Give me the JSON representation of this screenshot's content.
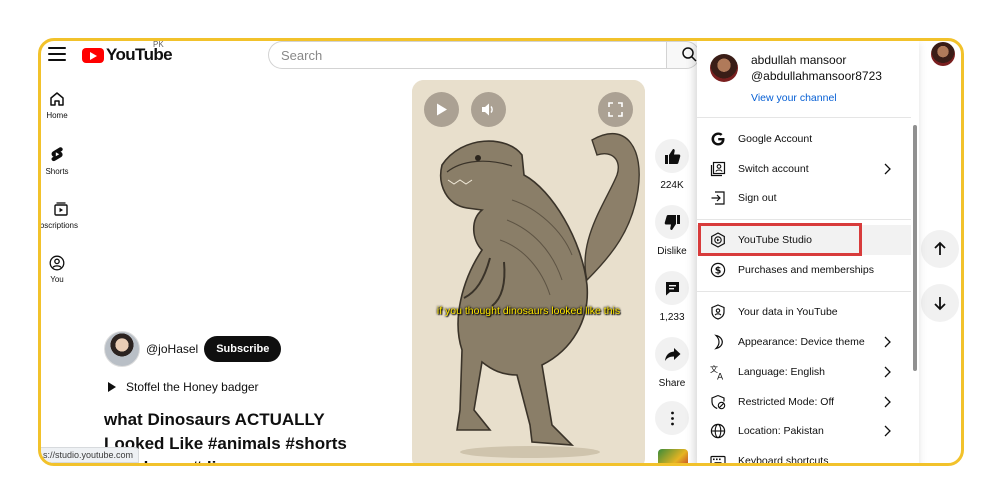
{
  "header": {
    "logo_text": "YouTube",
    "region": "PK",
    "search_placeholder": "Search"
  },
  "nav": [
    {
      "label": "Home",
      "icon": "home-icon"
    },
    {
      "label": "Shorts",
      "icon": "shorts-icon"
    },
    {
      "label": "Subscriptions",
      "icon": "subscriptions-icon"
    },
    {
      "label": "You",
      "icon": "you-icon"
    }
  ],
  "short": {
    "caption": "if you thought dinosaurs looked like this"
  },
  "actions": {
    "likes": "224K",
    "dislike": "Dislike",
    "comments": "1,233",
    "share": "Share"
  },
  "channel": {
    "name": "@joHasel",
    "subscribe_label": "Subscribe"
  },
  "music": "Stoffel the Honey badger",
  "video_title": "what Dinosaurs ACTUALLY Looked Like #animals #shorts #youknow #dinosaur",
  "status_url": "s://studio.youtube.com",
  "account_menu": {
    "name": "abdullah mansoor",
    "handle": "@abdullahmansoor8723",
    "view_channel": "View your channel",
    "items": [
      {
        "label": "Google Account",
        "icon": "google-icon"
      },
      {
        "label": "Switch account",
        "icon": "switch-account-icon",
        "chevron": true
      },
      {
        "label": "Sign out",
        "icon": "sign-out-icon"
      },
      {
        "label": "YouTube Studio",
        "icon": "youtube-studio-icon",
        "highlighted": true
      },
      {
        "label": "Purchases and memberships",
        "icon": "purchases-icon"
      },
      {
        "label": "Your data in YouTube",
        "icon": "shield-user-icon"
      },
      {
        "label": "Appearance: Device theme",
        "icon": "moon-icon",
        "chevron": true
      },
      {
        "label": "Language: English",
        "icon": "translate-icon",
        "chevron": true
      },
      {
        "label": "Restricted Mode: Off",
        "icon": "restricted-icon",
        "chevron": true
      },
      {
        "label": "Location: Pakistan",
        "icon": "globe-icon",
        "chevron": true
      },
      {
        "label": "Keyboard shortcuts",
        "icon": "keyboard-icon"
      }
    ]
  },
  "colors": {
    "frame": "#f2c22b",
    "highlight": "#d83b3b",
    "link": "#065fd4",
    "brand": "#ff0000",
    "caption": "#ffe600"
  }
}
